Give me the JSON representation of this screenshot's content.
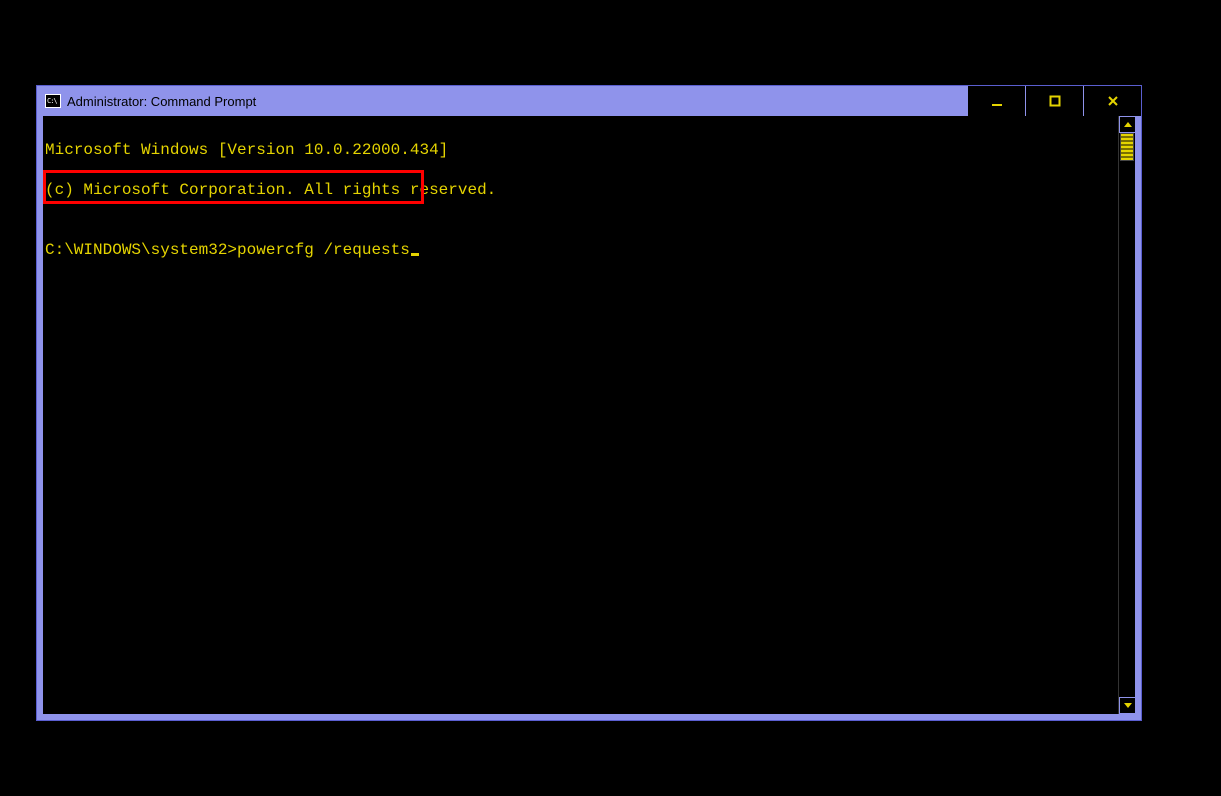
{
  "window": {
    "title": "Administrator: Command Prompt"
  },
  "console": {
    "line1": "Microsoft Windows [Version 10.0.22000.434]",
    "line2": "(c) Microsoft Corporation. All rights reserved.",
    "blank": "",
    "prompt": "C:\\WINDOWS\\system32>",
    "command": "powercfg /requests"
  },
  "colors": {
    "accent": "#8f93eb",
    "text": "#e5d400",
    "highlight": "#ff0000"
  }
}
